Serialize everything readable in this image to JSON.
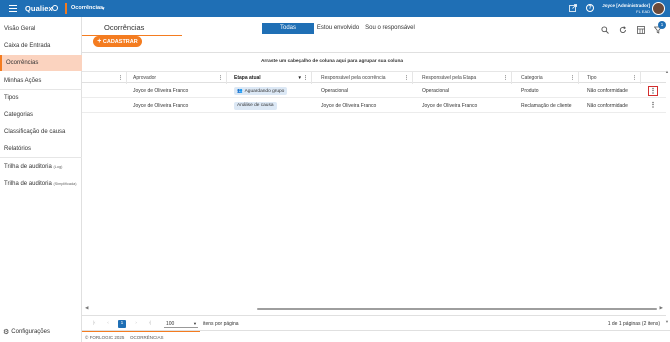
{
  "topbar": {
    "brand": "Qualiex",
    "module": "Ocorrências",
    "user_name": "Joyce [Administrador]",
    "user_org": "FL EAD",
    "icons": [
      "menu-icon",
      "logo-icon",
      "chevron-down-icon",
      "external-link-icon",
      "help-icon",
      "avatar"
    ]
  },
  "sidebar": {
    "items": [
      {
        "label": "Visão Geral"
      },
      {
        "label": "Caixa de Entrada"
      },
      {
        "label": "Ocorrências"
      },
      {
        "label": "Minhas Ações"
      },
      {
        "label": "Tipos"
      },
      {
        "label": "Categorias"
      },
      {
        "label": "Classificação de causa"
      },
      {
        "label": "Relatórios"
      },
      {
        "label": "Trilha de auditoria",
        "suffix": "(Log)"
      },
      {
        "label": "Trilha de auditoria",
        "suffix": "(Simplificada)"
      }
    ],
    "config_label": "Configurações"
  },
  "header": {
    "title": "Ocorrências",
    "add_button": "CADASTRAR",
    "filters": [
      "Todas",
      "Estou envolvido",
      "Sou o responsável"
    ],
    "active_filter": "Todas",
    "filter_badge": "1"
  },
  "grid": {
    "group_hint": "Arraste um cabeçalho de coluna aqui para agrupar sua coluna",
    "columns": [
      "",
      "Aprovador",
      "Etapa atual",
      "Responsável pela ocorrência",
      "Responsável pela Etapa",
      "Categoria",
      "Tipo"
    ],
    "rows": [
      {
        "aprovador": "Joyce de Oliveira Franco",
        "etapa": "Aguardando grupo",
        "resp_ocorrencia": "Operacional",
        "resp_etapa": "Operacional",
        "categoria": "Produto",
        "tipo": "Não conformidade"
      },
      {
        "aprovador": "Joyce de Oliveira Franco",
        "etapa": "Análise de causa",
        "resp_ocorrencia": "Joyce de Oliveira Franco",
        "resp_etapa": "Joyce de Oliveira Franco",
        "categoria": "Reclamação de cliente",
        "tipo": "Não conformidade"
      }
    ]
  },
  "pager": {
    "current_page": "1",
    "page_size": "100",
    "page_size_label": "itens por página",
    "info": "1 de 1 páginas (2 itens)"
  },
  "footer": {
    "copyright": "© FORLOGIC 2025",
    "path": "OCORRÊNCIAS"
  },
  "colors": {
    "primary": "#1f6fb5",
    "accent": "#f47c20",
    "active_bg": "#fbd3bf",
    "chip_bg": "#dce8f5"
  }
}
